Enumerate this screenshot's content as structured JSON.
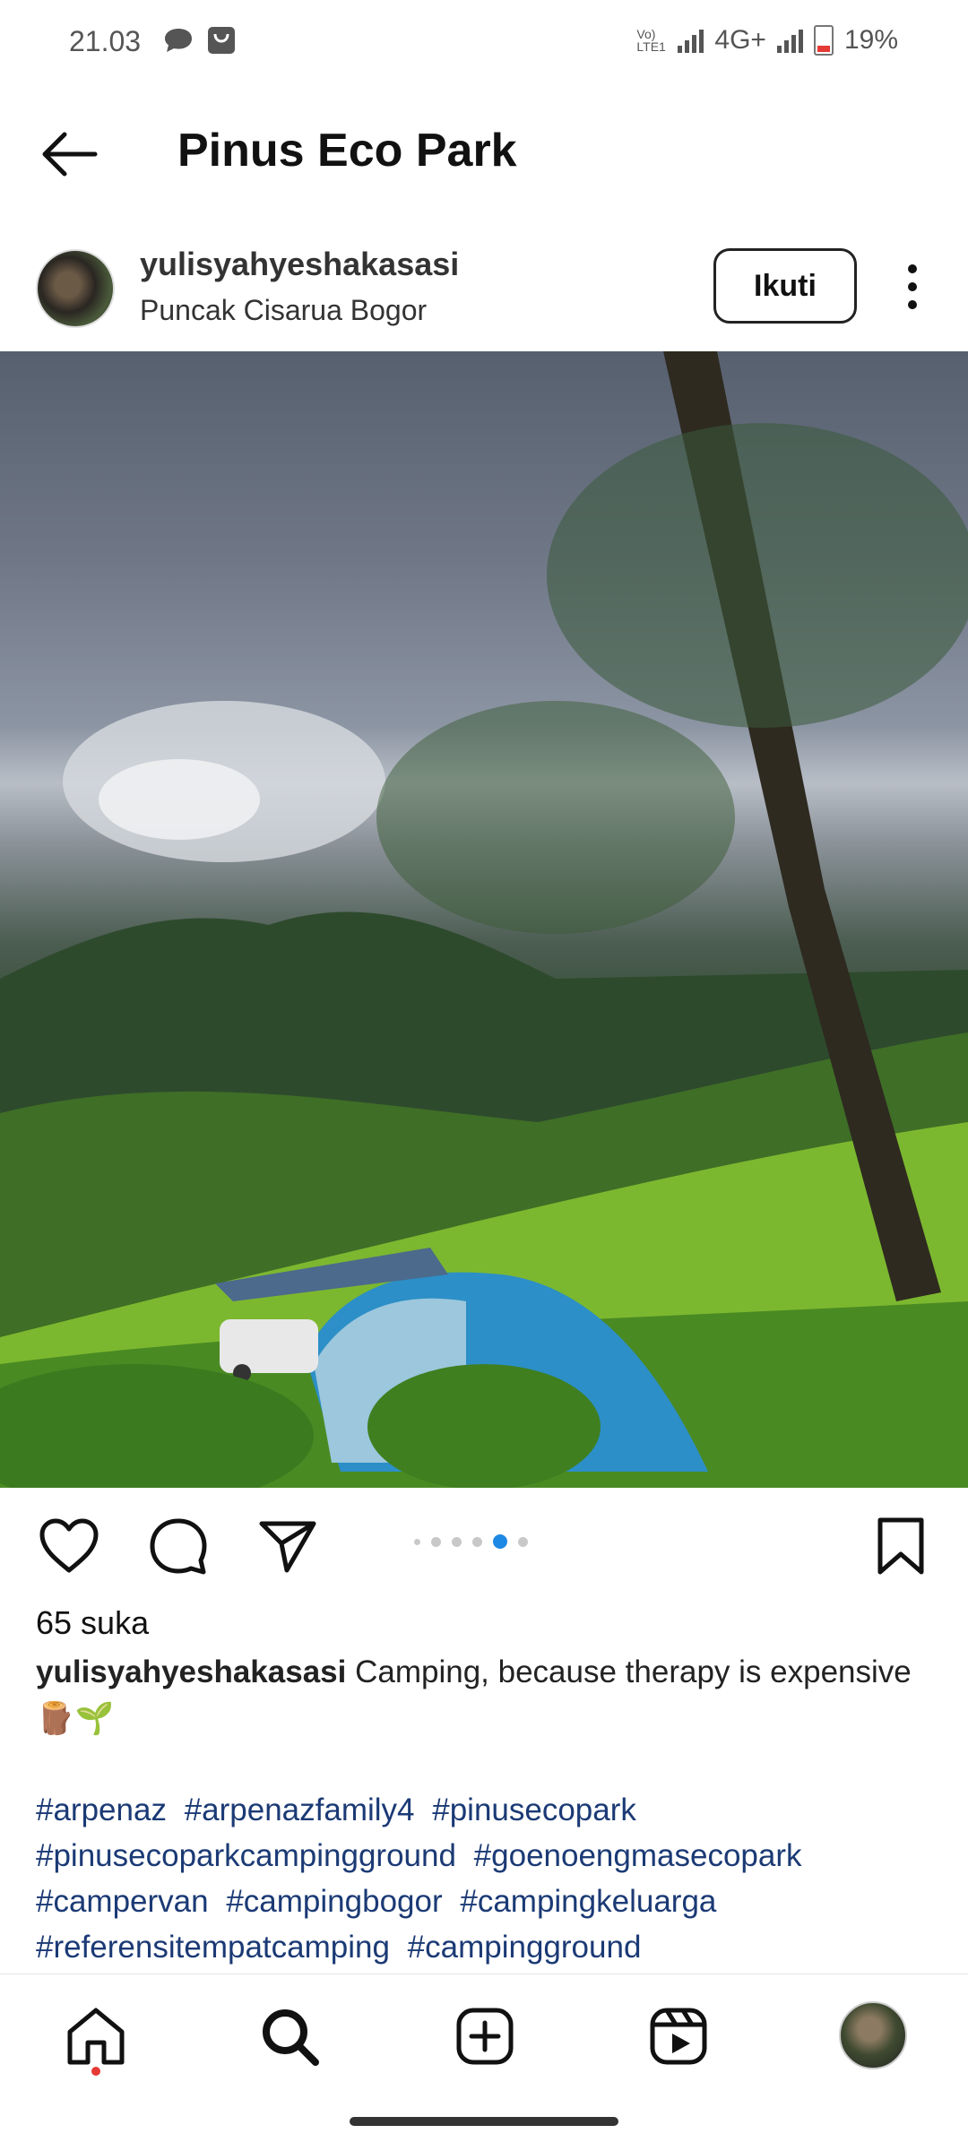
{
  "status_bar": {
    "time": "21.03",
    "network": "4G+",
    "volte": "Vo) LTE1",
    "battery": "19%",
    "icons": [
      "chat-icon",
      "bag-icon",
      "signal-icon",
      "battery-icon"
    ]
  },
  "header": {
    "title": "Pinus Eco Park",
    "back_icon": "back-arrow-icon"
  },
  "post": {
    "username": "yulisyahyeshakasasi",
    "location": "Puncak Cisarua Bogor",
    "follow_label": "Ikuti",
    "likes": "65 suka",
    "caption_user": "yulisyahyeshakasasi",
    "caption_text": "Camping, because therapy is expensive🪵🌱",
    "hashtags": [
      "#arpenaz",
      "#arpenazfamily4",
      "#pinusecopark",
      "#pinusecoparkcampingground",
      "#goenoengmasecopark",
      "#campervan",
      "#campingbogor",
      "#campingkeluarga",
      "#referensitempatcamping",
      "#campingground"
    ],
    "carousel": {
      "total": 6,
      "active_index": 4
    }
  },
  "bottom_nav": {
    "items": [
      "home-icon",
      "search-icon",
      "add-icon",
      "reels-icon",
      "profile-avatar"
    ],
    "active": "search"
  },
  "colors": {
    "accent": "#1e88e5",
    "hashtag": "#1b3a75",
    "notification_dot": "#e53935"
  }
}
